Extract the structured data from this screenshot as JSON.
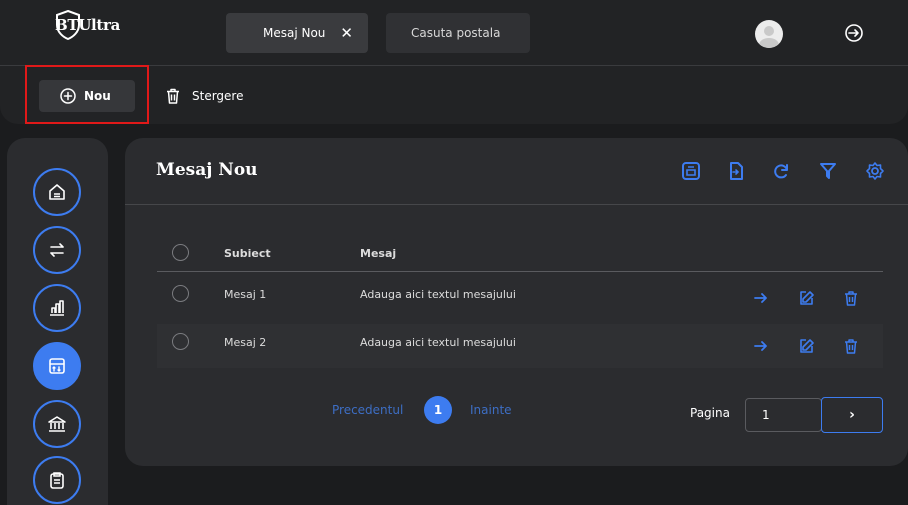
{
  "app": {
    "logo_text": "BTUltra"
  },
  "tabs": [
    {
      "label": "Mesaj Nou",
      "close": "✕"
    },
    {
      "label": "Casuta postala"
    }
  ],
  "toolbar": {
    "new_label": "Nou",
    "delete_label": "Stergere"
  },
  "sidebar": {
    "items": [
      "home-icon",
      "transfer-icon",
      "chart-icon",
      "inbox-icon",
      "bank-icon",
      "clipboard-icon"
    ],
    "active_index": 3
  },
  "main": {
    "title": "Mesaj Nou",
    "toolbar_icons": [
      "print-icon",
      "export-icon",
      "refresh-icon",
      "filter-icon",
      "settings-icon"
    ],
    "columns": {
      "subject": "Subiect",
      "message": "Mesaj"
    },
    "rows": [
      {
        "subject": "Mesaj 1",
        "message": "Adauga aici textul mesajului"
      },
      {
        "subject": "Mesaj 2",
        "message": "Adauga aici textul mesajului"
      }
    ],
    "pagination": {
      "prev": "Precedentul",
      "current": "1",
      "next": "Inainte",
      "page_label": "Pagina",
      "page_value": "1",
      "go": "›"
    }
  },
  "colors": {
    "accent": "#3d7cf0",
    "highlight": "#e01919",
    "background": "#1b1c1e",
    "panel": "#2b2c2f"
  }
}
